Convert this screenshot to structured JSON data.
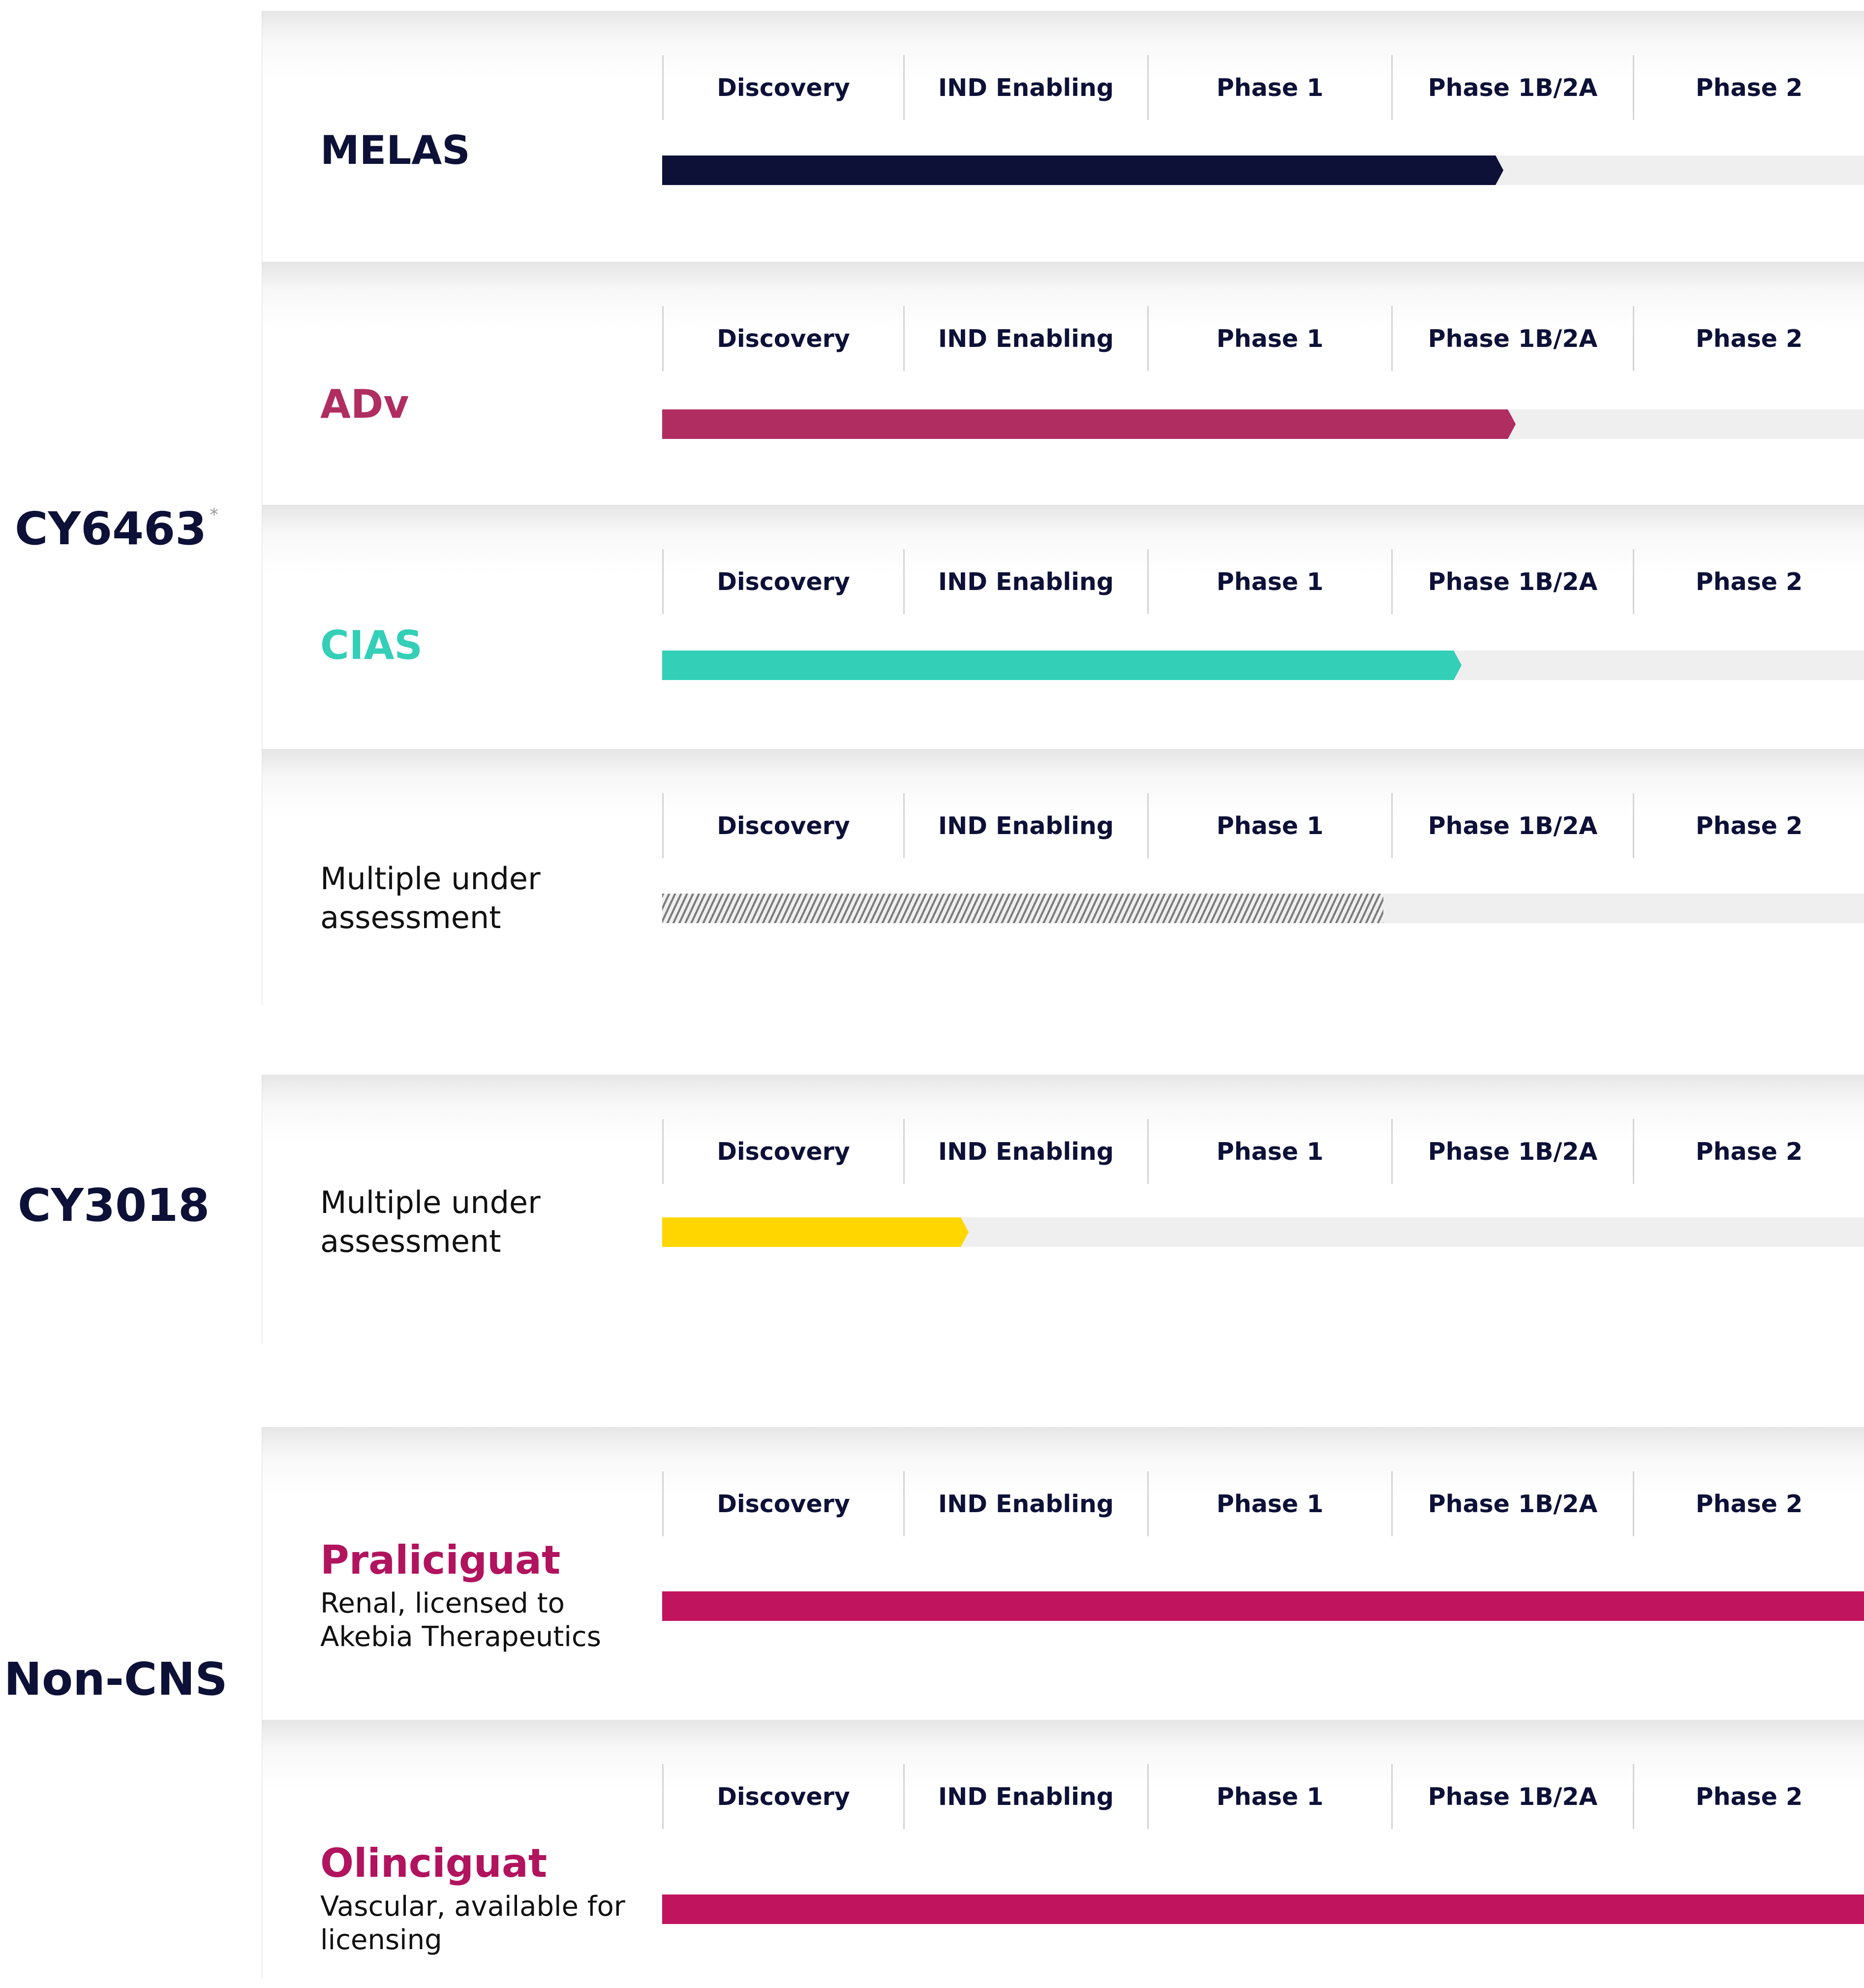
{
  "phases": [
    "Discovery",
    "IND Enabling",
    "Phase 1",
    "Phase 1B/2A",
    "Phase 2"
  ],
  "groups": [
    {
      "label": "CY6463",
      "marker": "*"
    },
    {
      "label": "CY3018"
    },
    {
      "label": "Non-CNS"
    }
  ],
  "rows": [
    {
      "group": "CY6463",
      "name": "MELAS",
      "name_color": "#0d1137",
      "bar_color": "#0d1137",
      "style": "solid",
      "progress": 0.7
    },
    {
      "group": "CY6463",
      "name": "ADv",
      "name_color": "#b02d62",
      "bar_color": "#b02d62",
      "style": "solid",
      "progress": 0.71
    },
    {
      "group": "CY6463",
      "name": "CIAS",
      "name_color": "#33cfb7",
      "bar_color": "#33cfb7",
      "style": "solid",
      "progress": 0.665
    },
    {
      "group": "CY6463",
      "text": "Multiple under assessment",
      "bar_color": "#7a7a7a",
      "style": "hatched",
      "progress": 0.6
    },
    {
      "group": "CY3018",
      "text": "Multiple under assessment",
      "bar_color": "#ffd600",
      "style": "solid",
      "progress": 0.255
    },
    {
      "group": "Non-CNS",
      "name": "Praliciguat",
      "sub": "Renal, licensed to Akebia Therapeutics",
      "name_color": "#b1135e",
      "bar_color": "#c0145f",
      "style": "solid",
      "progress": 1.0
    },
    {
      "group": "Non-CNS",
      "name": "Olinciguat",
      "sub": "Vascular, available for licensing",
      "name_color": "#b1135e",
      "bar_color": "#c0145f",
      "style": "solid",
      "progress": 1.0
    }
  ],
  "chart_data": {
    "type": "bar",
    "orientation": "horizontal",
    "categories": [
      "MELAS",
      "ADv",
      "CIAS",
      "Multiple under assessment",
      "Multiple under assessment",
      "Praliciguat",
      "Olinciguat"
    ],
    "groups": [
      "CY6463",
      "CY6463",
      "CY6463",
      "CY6463",
      "CY3018",
      "Non-CNS",
      "Non-CNS"
    ],
    "stage_labels": [
      "Discovery",
      "IND Enabling",
      "Phase 1",
      "Phase 1B/2A",
      "Phase 2"
    ],
    "values": [
      0.7,
      0.71,
      0.665,
      0.6,
      0.255,
      1.0,
      1.0
    ],
    "xlim": [
      0,
      1
    ],
    "grid": false,
    "legend": "none"
  }
}
